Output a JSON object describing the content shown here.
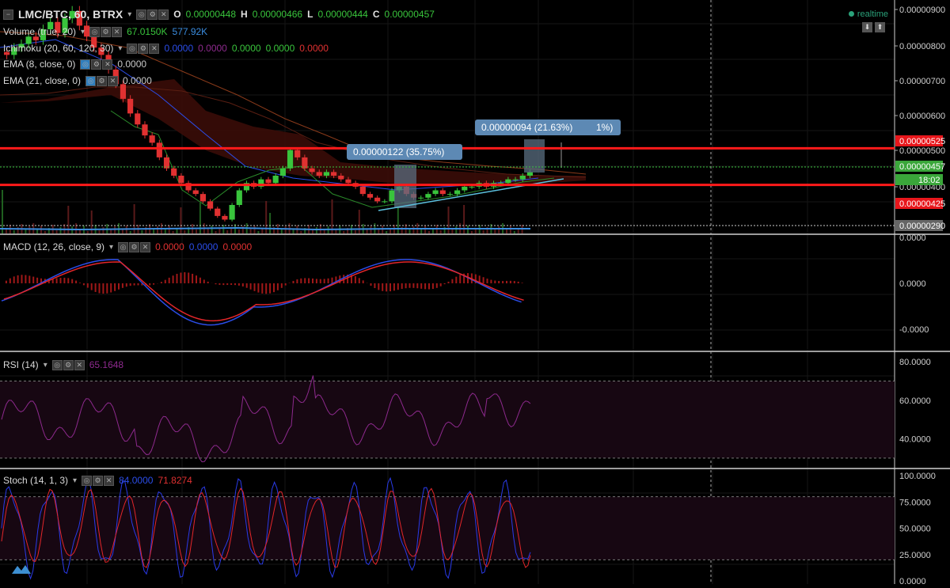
{
  "header": {
    "symbol": "LMC/BTC, 60, BTRX",
    "o_label": "O",
    "o_value": "0.00000448",
    "h_label": "H",
    "h_value": "0.00000466",
    "l_label": "L",
    "l_value": "0.00000444",
    "c_label": "C",
    "c_value": "0.00000457",
    "realtime": "realtime"
  },
  "indicators": {
    "volume": {
      "label": "Volume (true, 20)",
      "v1": "67.0150K",
      "v2": "577.92K"
    },
    "ichimoku": {
      "label": "Ichimoku (20, 60, 120, 30)",
      "values": [
        "0.0000",
        "0.0000",
        "0.0000",
        "0.0000",
        "0.0000"
      ]
    },
    "ema8": {
      "label": "EMA (8, close, 0)",
      "value": "0.0000"
    },
    "ema21": {
      "label": "EMA (21, close, 0)",
      "value": "0.0000"
    },
    "macd": {
      "label": "MACD (12, 26, close, 9)",
      "values": [
        "0.0000",
        "0.0000",
        "0.0000"
      ]
    },
    "rsi": {
      "label": "RSI (14)",
      "value": "65.1648"
    },
    "stoch": {
      "label": "Stoch (14, 1, 3)",
      "k": "84.0000",
      "d": "71.8274"
    }
  },
  "annotations": {
    "measure1": "0.00000122 (35.75%)",
    "measure2": "0.00000094 (21.63%)",
    "measure2_partial": "1%)"
  },
  "price_axis": {
    "ticks": [
      "0.00000900",
      "0.00000800",
      "0.00000700",
      "0.00000600",
      "0.00000500",
      "0.00000400"
    ],
    "badges": {
      "resistance": "0.00000525",
      "price": "0.00000457",
      "countdown": "18:02",
      "support": "0.00000425",
      "volume_level": "0.00000290"
    }
  },
  "macd_axis": [
    "0.0000",
    "0.0000",
    "-0.0000"
  ],
  "rsi_axis": [
    "80.0000",
    "60.0000",
    "40.0000"
  ],
  "stoch_axis": [
    "100.0000",
    "75.0000",
    "50.0000",
    "25.0000",
    "0.0000"
  ],
  "colors": {
    "up": "#39c43c",
    "down": "#e03131",
    "resistance_line": "#ff1a1a",
    "macd": "#2b4de8",
    "signal": "#e3262a",
    "rsi": "#8e2a8e",
    "stoch_k": "#2a3ae8",
    "stoch_d": "#e3262a",
    "trendline": "#5bc0de"
  },
  "chart_data": {
    "type": "candlestick",
    "price": {
      "ylim": [
        2.9e-06,
        9.3e-06
      ],
      "resistance": 5.25e-06,
      "support": 4.25e-06,
      "candles_close": [
        7.8e-06,
        8e-06,
        8.1e-06,
        8.3e-06,
        8.2e-06,
        8.5e-06,
        8.7e-06,
        8.4e-06,
        8.8e-06,
        9e-06,
        8.6e-06,
        8.3e-06,
        8e-06,
        7.8e-06,
        7.4e-06,
        7e-06,
        6.6e-06,
        6.2e-06,
        5.9e-06,
        5.6e-06,
        5.4e-06,
        5e-06,
        4.7e-06,
        4.5e-06,
        4.3e-06,
        4.1e-06,
        4e-06,
        3.8e-06,
        3.6e-06,
        3.4e-06,
        3.3e-06,
        3.7e-06,
        4.1e-06,
        4.3e-06,
        4.2e-06,
        4.4e-06,
        4.3e-06,
        4.5e-06,
        4.7e-06,
        5.2e-06,
        5e-06,
        4.7e-06,
        4.6e-06,
        4.5e-06,
        4.6e-06,
        4.5e-06,
        4.4e-06,
        4.3e-06,
        4.2e-06,
        4e-06,
        3.9e-06,
        3.8e-06,
        3.8e-06,
        4.1e-06,
        4.2e-06,
        4e-06,
        3.9e-06,
        3.9e-06,
        4e-06,
        4.1e-06,
        4e-06,
        4e-06,
        4.1e-06,
        4.2e-06,
        4.2e-06,
        4.3e-06,
        4.2e-06,
        4.3e-06,
        4.3e-06,
        4.4e-06,
        4.4e-06,
        4.5e-06,
        4.6e-06
      ]
    },
    "macd": {
      "ylim": [
        -1,
        1
      ]
    },
    "rsi": {
      "ylim": [
        25,
        85
      ],
      "upper": 70,
      "lower": 30
    },
    "stoch": {
      "ylim": [
        0,
        100
      ],
      "upper": 80,
      "lower": 20
    }
  }
}
